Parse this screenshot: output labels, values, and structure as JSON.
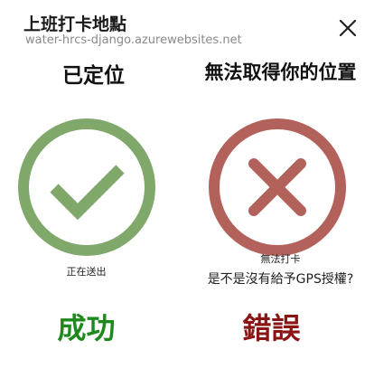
{
  "header": {
    "title": "上班打卡地點",
    "url": "water-hrcs-django.azurewebsites.net"
  },
  "left": {
    "headline": "已定位",
    "caption": "正在送出",
    "result": "成功",
    "icon": "check-icon",
    "circle_color": "#7fa86a",
    "result_color": "#1e8a1e"
  },
  "right": {
    "headline": "無法取得你的位置",
    "caption1": "無法打卡",
    "caption2": "是不是沒有給予GPS授權?",
    "result": "錯誤",
    "icon": "x-icon",
    "circle_color": "#b3625b",
    "result_color": "#8b1414"
  }
}
